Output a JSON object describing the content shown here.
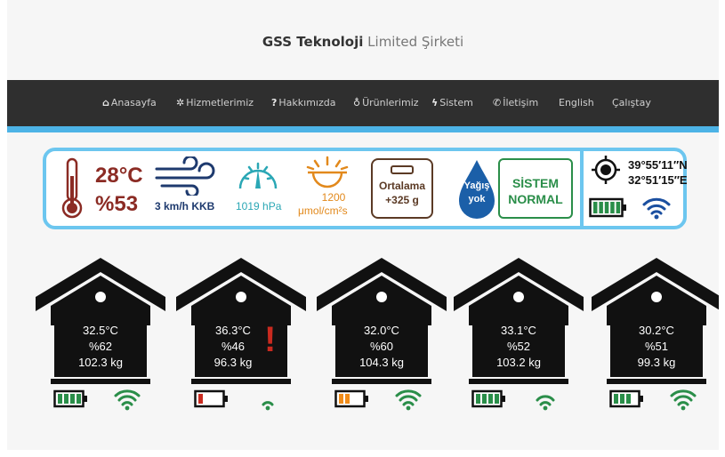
{
  "header": {
    "brand_bold": "GSS Teknoloji",
    "brand_rest": "Limited Şirketi"
  },
  "nav": [
    {
      "icon": "home-icon",
      "glyph": "⌂",
      "label": "Anasayfa"
    },
    {
      "icon": "gears-icon",
      "glyph": "✲",
      "label": "Hizmetlerimiz"
    },
    {
      "icon": "question-icon",
      "glyph": "?",
      "label": "Hakkımızda"
    },
    {
      "icon": "bulb-icon",
      "glyph": "♁",
      "label": "Ürünlerimiz"
    },
    {
      "icon": "bolt-icon",
      "glyph": "ϟ",
      "label": "Sistem"
    },
    {
      "icon": "phone-icon",
      "glyph": "✆",
      "label": "İletişim"
    },
    {
      "icon": "",
      "glyph": "",
      "label": "English"
    },
    {
      "icon": "",
      "glyph": "",
      "label": "Çalıştay"
    }
  ],
  "weather": {
    "temperature": "28°C",
    "humidity": "%53",
    "wind": "3 km/h KKB",
    "pressure": "1019 hPa",
    "radiation_value": "1200",
    "radiation_unit": "μmol/cm²s",
    "scale_label": "Ortalama",
    "scale_value": "+325 g",
    "rain_line1": "Yağış",
    "rain_line2": "yok",
    "system_line1": "SİSTEM",
    "system_line2": "NORMAL",
    "latitude": "39°55′11″N",
    "longitude": "32°51′15″E",
    "gateway_battery_level": 1.0,
    "colors": {
      "panel_border": "#6cc6ef",
      "temp": "#8b2b24",
      "system": "#2a8e49"
    }
  },
  "hives": [
    {
      "temperature": "32.5°C",
      "humidity": "%62",
      "weight": "102.3 kg",
      "alert": "",
      "battery_level": 1.0,
      "battery_color": "#2a8e49",
      "signal_level": 4
    },
    {
      "temperature": "36.3°C",
      "humidity": "%46",
      "weight": "96.3 kg",
      "alert": "!",
      "battery_level": 0.25,
      "battery_color": "#c92a1f",
      "signal_level": 2
    },
    {
      "temperature": "32.0°C",
      "humidity": "%60",
      "weight": "104.3 kg",
      "alert": "",
      "battery_level": 0.5,
      "battery_color": "#f08c1a",
      "signal_level": 4
    },
    {
      "temperature": "33.1°C",
      "humidity": "%52",
      "weight": "103.2 kg",
      "alert": "",
      "battery_level": 1.0,
      "battery_color": "#2a8e49",
      "signal_level": 3
    },
    {
      "temperature": "30.2°C",
      "humidity": "%51",
      "weight": "99.3 kg",
      "alert": "",
      "battery_level": 0.75,
      "battery_color": "#2a8e49",
      "signal_level": 4
    }
  ]
}
